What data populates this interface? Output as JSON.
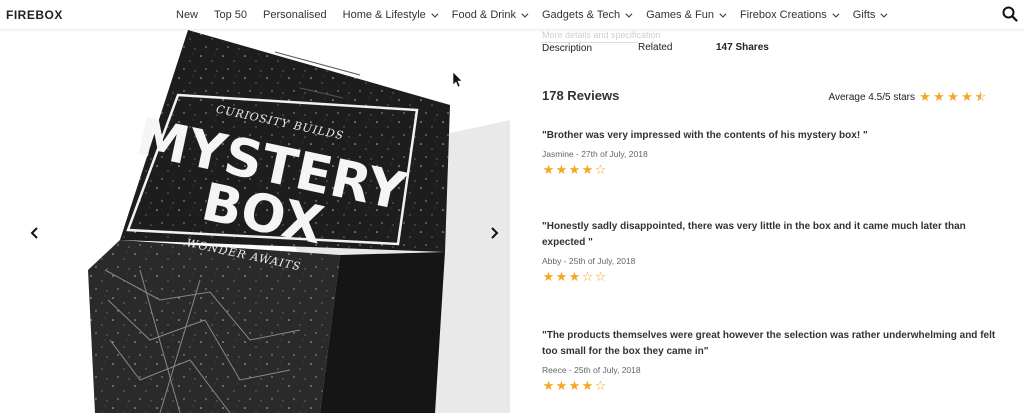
{
  "brand": "FIREBOX",
  "nav": [
    {
      "label": "New",
      "dropdown": false
    },
    {
      "label": "Top 50",
      "dropdown": false
    },
    {
      "label": "Personalised",
      "dropdown": false
    },
    {
      "label": "Home & Lifestyle",
      "dropdown": true
    },
    {
      "label": "Food & Drink",
      "dropdown": true
    },
    {
      "label": "Gadgets & Tech",
      "dropdown": true
    },
    {
      "label": "Games & Fun",
      "dropdown": true
    },
    {
      "label": "Firebox Creations",
      "dropdown": true
    },
    {
      "label": "Gifts",
      "dropdown": true
    }
  ],
  "product": {
    "box_text": {
      "top": "CURIOSITY BUILDS",
      "line1": "MYSTERY",
      "line2": "BOX",
      "bottom": "WONDER AWAITS"
    }
  },
  "tabs": {
    "faded_text": "More details and specification",
    "description": "Description",
    "related": "Related",
    "shares": "147 Shares"
  },
  "reviews": {
    "heading": "178 Reviews",
    "average_label": "Average 4.5/5 stars",
    "average_rating": 4.5,
    "items": [
      {
        "quote": "\"Brother was very impressed with the contents of his mystery box! \"",
        "meta": "Jasmine - 27th of July, 2018",
        "rating": 4
      },
      {
        "quote": "\"Honestly sadly disappointed, there was very little in the box and it came much later than expected \"",
        "meta": "Abby - 25th of July, 2018",
        "rating": 3
      },
      {
        "quote": "\"The products themselves were great however the selection was rather underwhelming and felt too small for the box they came in\"",
        "meta": "Reece - 25th of July, 2018",
        "rating": 4
      }
    ]
  },
  "colors": {
    "star": "#f5a623",
    "box": "#1d1d1d",
    "text": "#333333"
  }
}
